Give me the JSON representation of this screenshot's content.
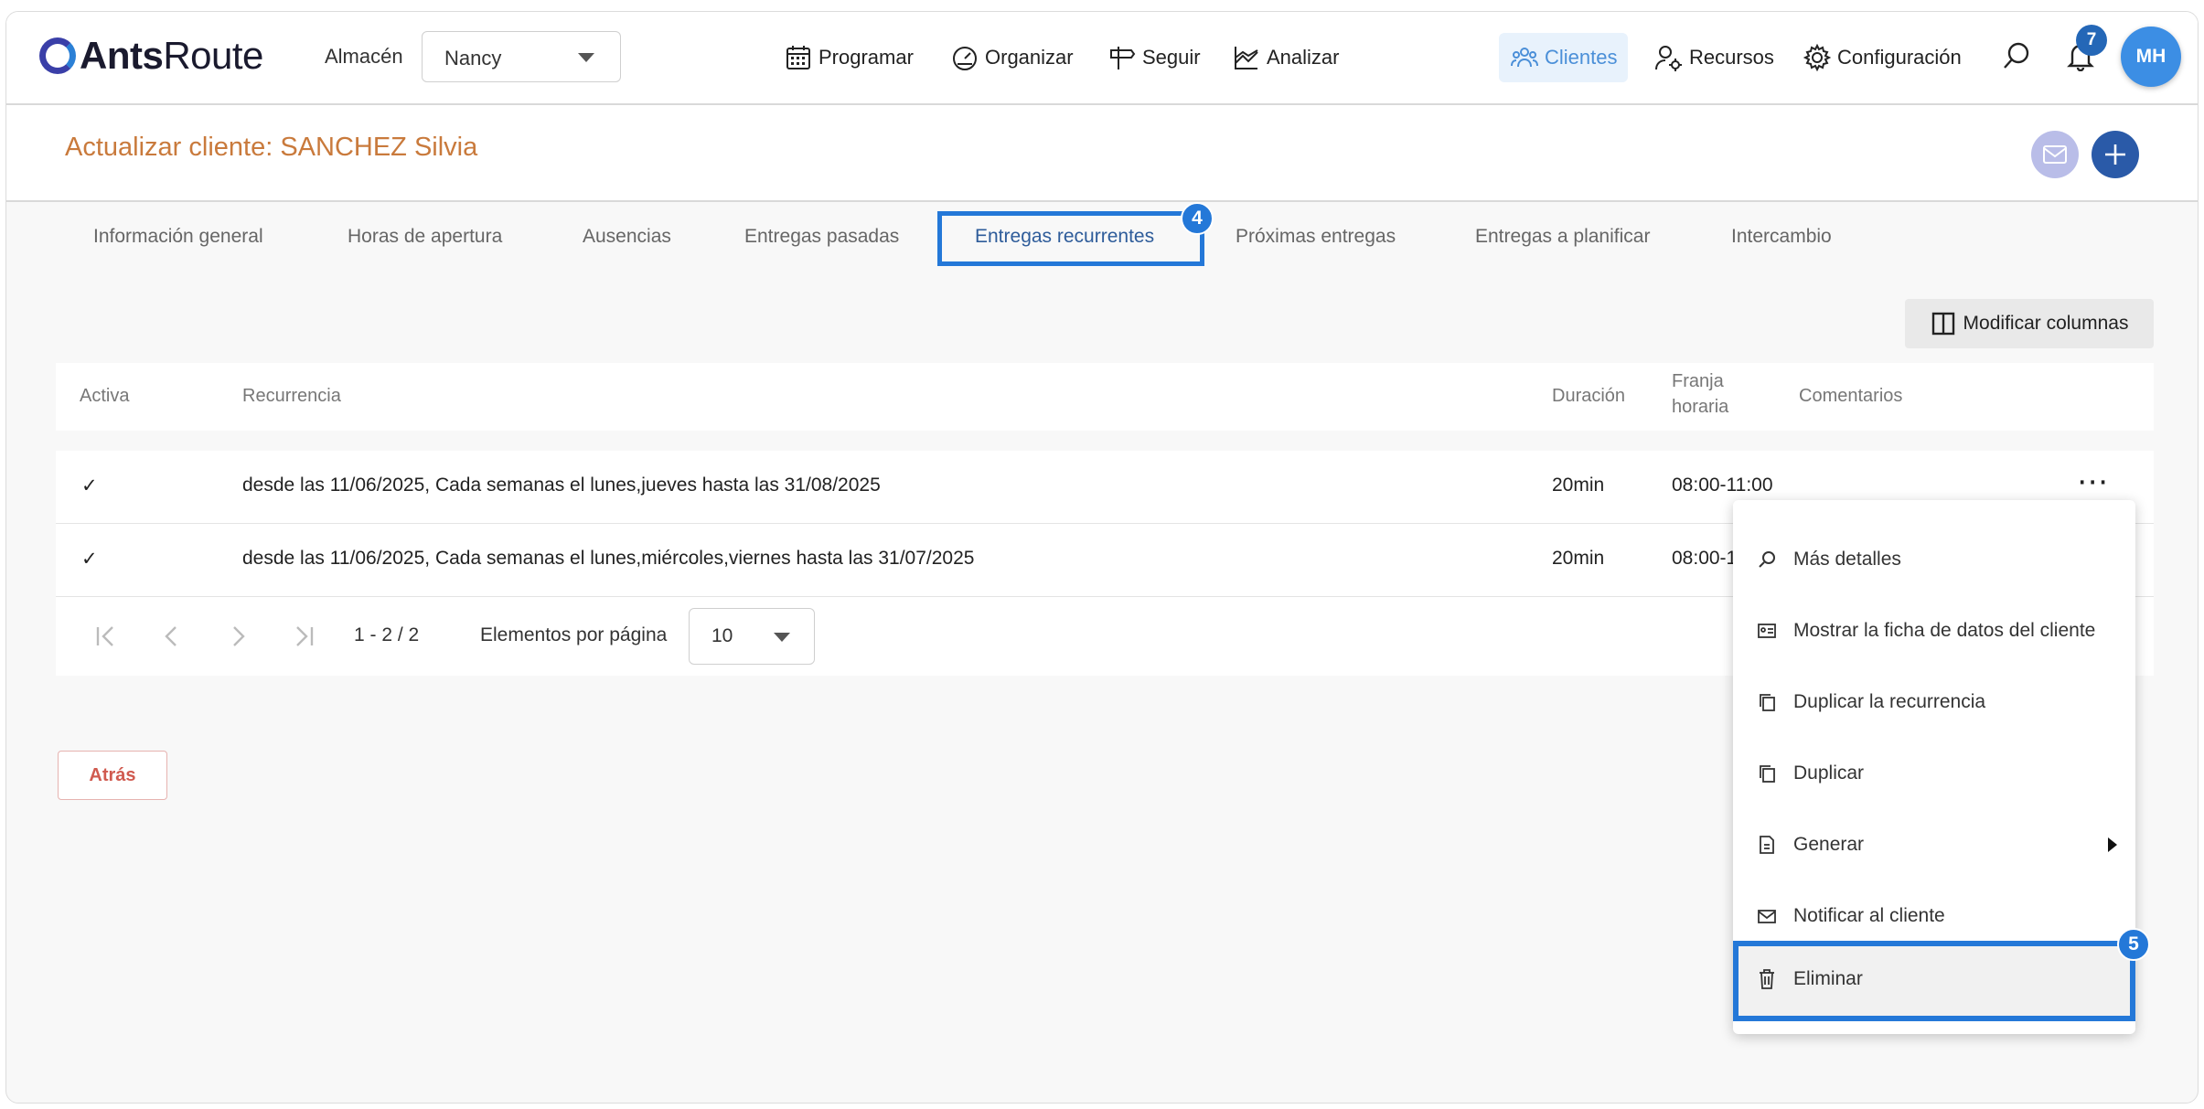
{
  "app": {
    "brand_bold": "Ants",
    "brand_light": "Route"
  },
  "topnav": {
    "warehouse_label": "Almacén",
    "warehouse_value": "Nancy",
    "items": [
      {
        "label": "Programar",
        "icon": "calendar-icon"
      },
      {
        "label": "Organizar",
        "icon": "speedometer-icon"
      },
      {
        "label": "Seguir",
        "icon": "signpost-icon"
      },
      {
        "label": "Analizar",
        "icon": "chart-icon"
      },
      {
        "label": "Clientes",
        "icon": "users-icon",
        "active": true
      },
      {
        "label": "Recursos",
        "icon": "user-gear-icon"
      },
      {
        "label": "Configuración",
        "icon": "gear-icon"
      }
    ],
    "notification_count": "7",
    "avatar_initials": "MH"
  },
  "page": {
    "title": "Actualizar cliente: SANCHEZ Silvia"
  },
  "tabs": [
    {
      "label": "Información general"
    },
    {
      "label": "Horas de apertura"
    },
    {
      "label": "Ausencias"
    },
    {
      "label": "Entregas pasadas"
    },
    {
      "label": "Entregas recurrentes",
      "active": true
    },
    {
      "label": "Próximas entregas"
    },
    {
      "label": "Entregas a planificar"
    },
    {
      "label": "Intercambio"
    }
  ],
  "steps": {
    "tab_step": "4",
    "menu_step": "5"
  },
  "toolbar": {
    "modify_columns": "Modificar columnas"
  },
  "table": {
    "headers": {
      "active": "Activa",
      "recurrence": "Recurrencia",
      "duration": "Duración",
      "slot_line1": "Franja",
      "slot_line2": "horaria",
      "comments": "Comentarios"
    },
    "rows": [
      {
        "active": "✓",
        "recurrence": "desde las 11/06/2025, Cada semanas el lunes,jueves hasta las 31/08/2025",
        "duration": "20min",
        "slot": "08:00-11:00",
        "comments": ""
      },
      {
        "active": "✓",
        "recurrence": "desde las 11/06/2025, Cada semanas el lunes,miércoles,viernes hasta las 31/07/2025",
        "duration": "20min",
        "slot": "08:00-1",
        "comments": ""
      }
    ],
    "row_actions": "⋯"
  },
  "pager": {
    "range": "1 - 2 / 2",
    "per_page_label": "Elementos por página",
    "per_page_value": "10"
  },
  "back_button": "Atrás",
  "context_menu": [
    {
      "label": "Más detalles",
      "icon": "zoom-icon"
    },
    {
      "label": "Mostrar la ficha de datos del cliente",
      "icon": "id-card-icon"
    },
    {
      "label": "Duplicar la recurrencia",
      "icon": "copy-icon"
    },
    {
      "label": "Duplicar",
      "icon": "copy-icon"
    },
    {
      "label": "Generar",
      "icon": "document-icon",
      "submenu": true
    },
    {
      "label": "Notificar al cliente",
      "icon": "mail-icon"
    },
    {
      "label": "Eliminar",
      "icon": "trash-icon",
      "highlighted": true
    }
  ],
  "colors": {
    "accent": "#2478d8",
    "title": "#c97a3c",
    "nav_active": "#4a8fd8",
    "danger": "#d05a4f"
  }
}
